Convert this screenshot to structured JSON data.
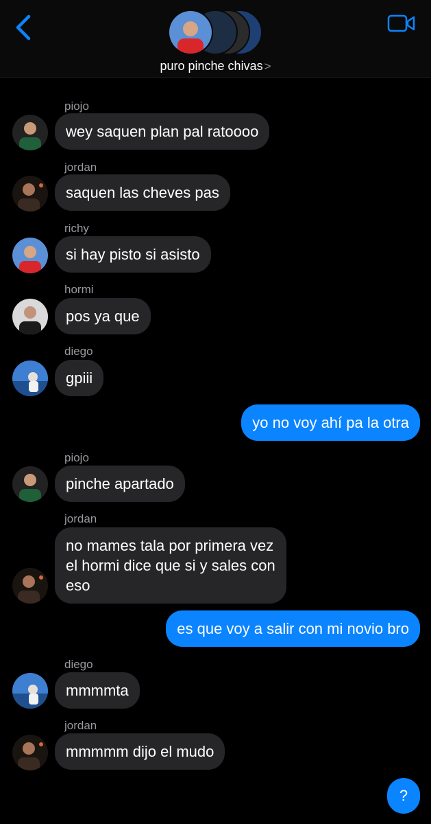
{
  "header": {
    "group_name": "puro pinche chivas",
    "chevron": ">",
    "icons": {
      "back": "chevron-left-icon",
      "video": "video-camera-icon"
    },
    "accent": "#0a84ff"
  },
  "messages": [
    {
      "sender": "piojo",
      "text": "wey saquen plan pal ratoooo"
    },
    {
      "sender": "jordan",
      "text": "saquen las cheves pas"
    },
    {
      "sender": "richy",
      "text": "si hay pisto si asisto"
    },
    {
      "sender": "hormi",
      "text": "pos ya que"
    },
    {
      "sender": "diego",
      "text": "gpiii"
    },
    {
      "text": "yo no voy ahí pa la otra"
    },
    {
      "sender": "piojo",
      "text": "pinche apartado"
    },
    {
      "sender": "jordan",
      "text": "no mames tala por primera vez el hormi dice que si y sales con eso"
    },
    {
      "text": "es que voy a salir con mi novio bro"
    },
    {
      "sender": "diego",
      "text": "mmmmta"
    },
    {
      "sender": "jordan",
      "text": "mmmmm dijo el mudo"
    }
  ],
  "help_button": "?"
}
